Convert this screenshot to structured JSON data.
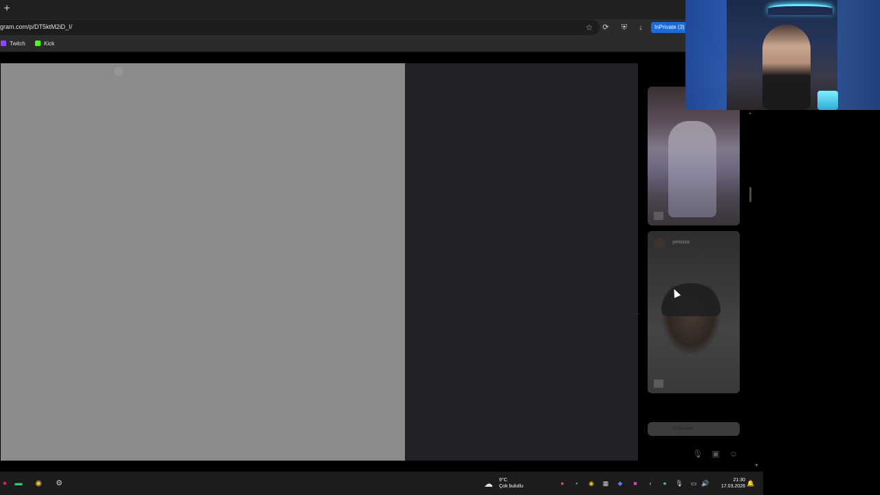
{
  "browser": {
    "url": "gram.com/p/DT5ktM2iD_I/",
    "inprivate_label": "InPrivate (3)",
    "bookmarks": [
      {
        "label": "Twitch",
        "icon": "twitch-icon",
        "color": "#9146ff"
      },
      {
        "label": "Kick",
        "icon": "kick-icon",
        "color": "#53fc18"
      }
    ]
  },
  "reels": {
    "items": [
      {
        "username": ""
      },
      {
        "username": "yemzza"
      },
      {
        "username": "vicki.aan"
      }
    ]
  },
  "taskbar": {
    "weather": {
      "temp": "9°C",
      "condition": "Çok bulutlu"
    },
    "time": "21:30",
    "date": "17.03.2026"
  },
  "colors": {
    "accent": "#1b6ad8",
    "media_placeholder": "#8b8b8b",
    "post_bg": "#202226"
  }
}
